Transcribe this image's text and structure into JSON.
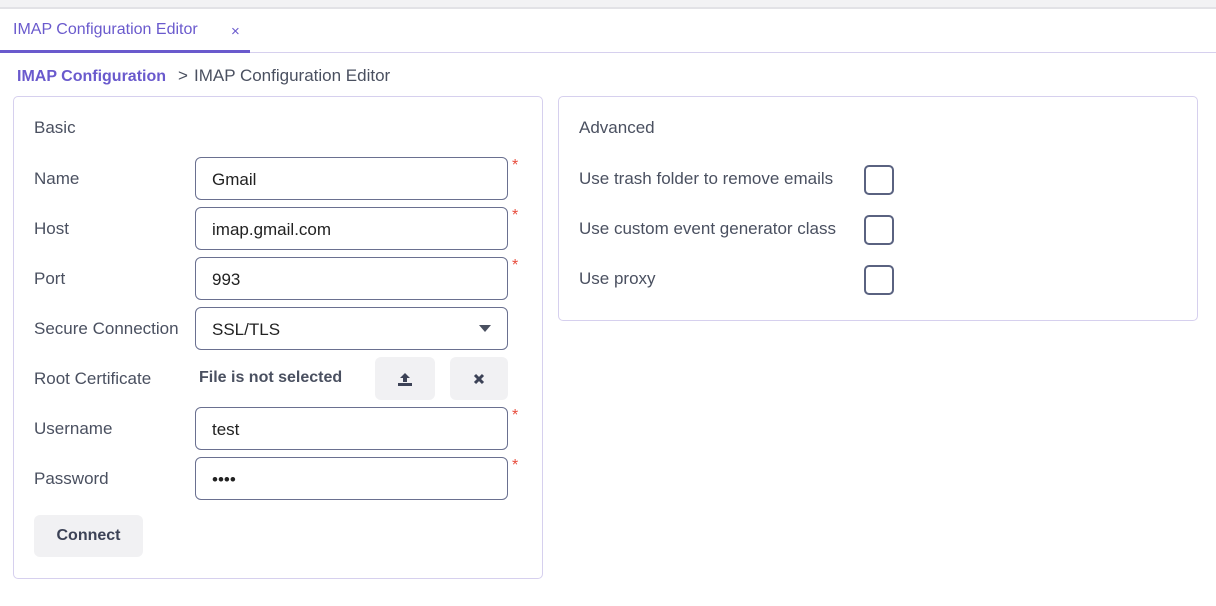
{
  "tab": {
    "label": "IMAP Configuration Editor",
    "close": "×"
  },
  "breadcrumb": {
    "parent": "IMAP Configuration",
    "separator": ">",
    "current": "IMAP Configuration Editor"
  },
  "basic": {
    "title": "Basic",
    "name": {
      "label": "Name",
      "value": "Gmail"
    },
    "host": {
      "label": "Host",
      "value": "imap.gmail.com"
    },
    "port": {
      "label": "Port",
      "value": "993"
    },
    "secure": {
      "label": "Secure Connection",
      "value": "SSL/TLS"
    },
    "cert": {
      "label": "Root Certificate",
      "status": "File is not selected"
    },
    "username": {
      "label": "Username",
      "value": "test"
    },
    "password": {
      "label": "Password",
      "value": "••••"
    },
    "required": "*",
    "connect": "Connect"
  },
  "advanced": {
    "title": "Advanced",
    "options": [
      {
        "label": "Use trash folder to remove emails",
        "checked": false
      },
      {
        "label": "Use custom event generator class",
        "checked": false
      },
      {
        "label": "Use proxy",
        "checked": false
      }
    ]
  },
  "colors": {
    "accent": "#6a5acd",
    "required": "#e74c3c"
  }
}
